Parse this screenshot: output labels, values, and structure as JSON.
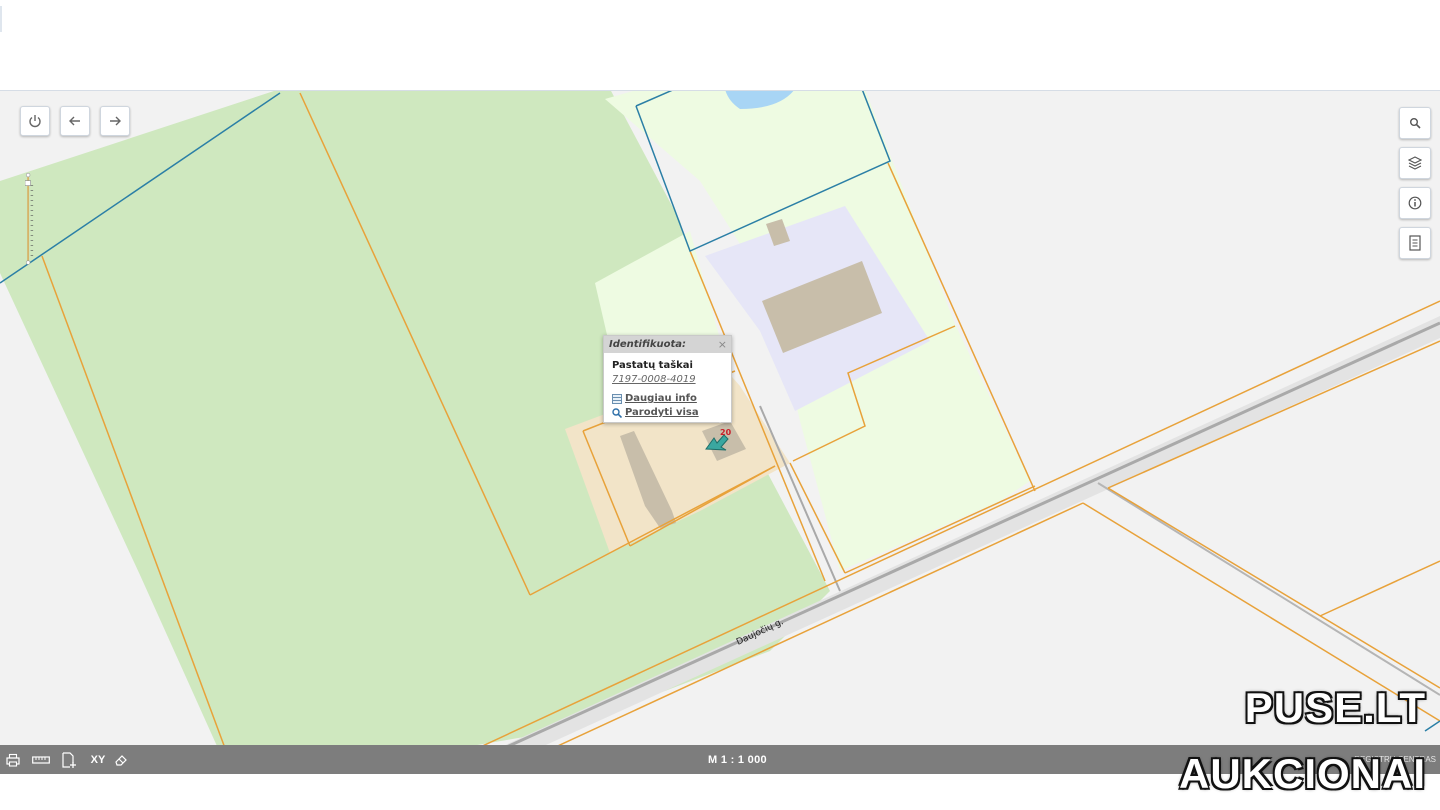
{
  "map": {
    "road_label": "Daujočių g.",
    "building_number": "20"
  },
  "controls": {
    "power_icon": "power-icon",
    "back_icon": "arrow-left-icon",
    "forward_icon": "arrow-right-icon",
    "right_panel": [
      "search-icon",
      "layers-icon",
      "info-icon",
      "document-icon"
    ]
  },
  "popup": {
    "header": "Identifikuota:",
    "close": "×",
    "title": "Pastatų taškai",
    "id": "7197-0008-4019",
    "more_info": "Daugiau info",
    "show_all": "Parodyti visa"
  },
  "bottom_bar": {
    "tools": [
      "print-icon",
      "ruler-icon",
      "add-document-icon",
      "XY",
      "eraser-icon"
    ],
    "xy_label": "XY",
    "scale": "M 1 : 1 000",
    "credit": "REGISTRŲ CENTRAS"
  },
  "watermark": {
    "line1": "PUSE.LT",
    "line2": "AUKCIONAI"
  },
  "colors": {
    "parcel_border": "#e8a23a",
    "blue_boundary": "#2b7fa6",
    "meadow": "#cfe8bf",
    "light_field": "#eefbe2",
    "yard": "#f2e4c8",
    "building": "#c8beaa",
    "paved_area": "#e6e6f7",
    "water": "#a8d5f5",
    "toolbar": "#7d7d7d"
  }
}
